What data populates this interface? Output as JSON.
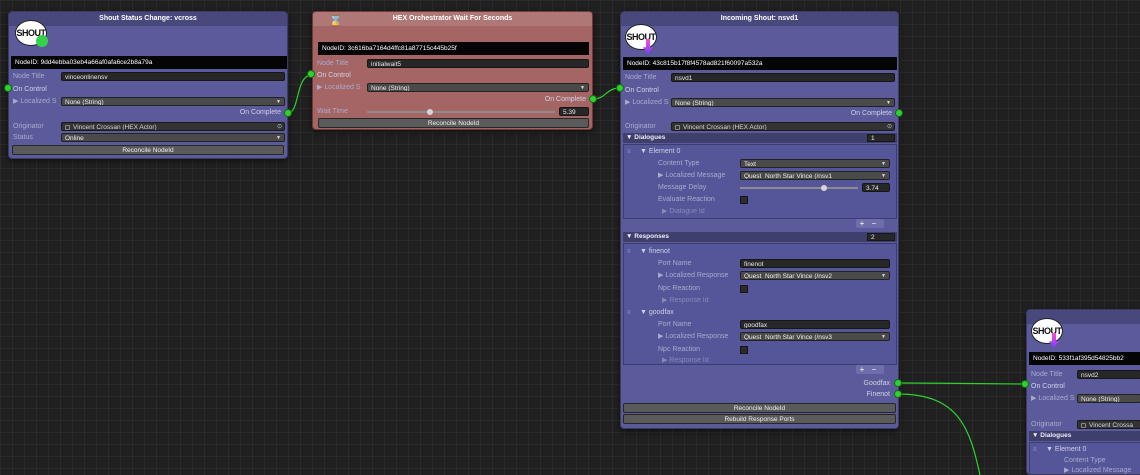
{
  "palette": {
    "canvas": "#202020",
    "shout_node": "#5b5b9b",
    "hex_node": "#a56565",
    "port": "#2fd12f"
  },
  "node1": {
    "title": "Shout Status Change: vcross",
    "logo": "SHOUT",
    "node_id": "NodeID: 9dd4ebba03eb4a66af0afa6ce2b8a79a",
    "node_title_label": "Node Title",
    "node_title_value": "vinceonlinensv",
    "on_control": "On Control",
    "localized_label": "Localized S",
    "localized_value": "None (String)",
    "on_complete": "On Complete",
    "originator_label": "Originator",
    "originator_value": "Vincent Crossan (HEX Actor)",
    "status_label": "Status",
    "status_value": "Online",
    "reconcile": "Reconcile NodeId"
  },
  "node2": {
    "title": "HEX Orchestrator Wait For Seconds",
    "node_id": "NodeID: 3c616ba7164d4ffc81a87715c445b25f",
    "node_title_label": "Node Title",
    "node_title_value": "initialwait5",
    "on_control": "On Control",
    "localized_label": "Localized S",
    "localized_value": "None (String)",
    "on_complete": "On Complete",
    "wait_label": "Wait Time",
    "wait_value": "5.39",
    "wait_fraction": 0.33,
    "reconcile": "Reconcile NodeId"
  },
  "node3": {
    "title": "Incoming Shout: nsvd1",
    "logo": "SHOUT",
    "node_id": "NodeID: 43c815b17f8f4578ad821f60097a532a",
    "node_title_label": "Node Title",
    "node_title_value": "nsvd1",
    "on_control": "On Control",
    "localized_label": "Localized S",
    "localized_value": "None (String)",
    "on_complete": "On Complete",
    "originator_label": "Originator",
    "originator_value": "Vincent Crossan (HEX Actor)",
    "dialogues": {
      "label": "Dialogues",
      "count": "1",
      "element_label": "Element 0",
      "content_type_label": "Content Type",
      "content_type_value": "Text",
      "localized_message_label": "Localized Message",
      "localized_message_value": "Quest_North Star Vince (/nsv1",
      "message_delay_label": "Message Delay",
      "message_delay_value": "3.74",
      "message_delay_fraction": 0.72,
      "evaluate_reaction_label": "Evaluate Reaction",
      "dialogue_id_label": "Dialogue Id"
    },
    "responses": {
      "label": "Responses",
      "count": "2",
      "items": [
        {
          "name": "finenot",
          "port_name_label": "Port Name",
          "port_name_value": "finenot",
          "localized_label": "Localized Response",
          "localized_value": "Quest_North Star Vince (/nsv2",
          "npc_label": "Npc Reaction",
          "id_label": "Response Id"
        },
        {
          "name": "goodfax",
          "port_name_label": "Port Name",
          "port_name_value": "goodfax",
          "localized_label": "Localized Response",
          "localized_value": "Quest_North Star Vince (/nsv3",
          "npc_label": "Npc Reaction",
          "id_label": "Response Id"
        }
      ]
    },
    "port_goodfax": "Goodfax",
    "port_finenot": "Finenot",
    "reconcile": "Reconcile NodeId",
    "rebuild": "Rebuild Response Ports"
  },
  "node4": {
    "logo": "SHOUT",
    "node_id": "NodeID: 533f1af395d54825bb2",
    "node_title_label": "Node Title",
    "node_title_value": "nsvd2",
    "on_control": "On Control",
    "localized_label": "Localized S",
    "localized_value": "None (String)",
    "originator_label": "Originator",
    "originator_value": "Vincent Crossa",
    "dialogues_label": "Dialogues",
    "element_label": "Element 0",
    "content_type_label": "Content Type",
    "localized_message_label": "Localized Message"
  }
}
